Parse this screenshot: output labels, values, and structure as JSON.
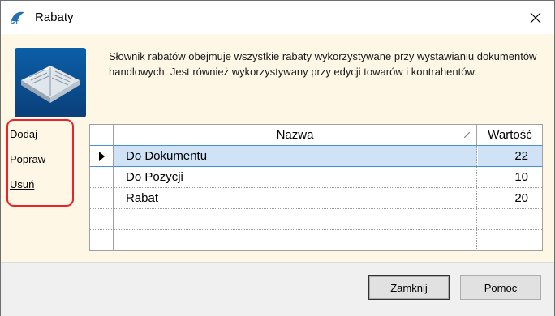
{
  "window": {
    "title": "Rabaty"
  },
  "description": "Słownik rabatów obejmuje wszystkie rabaty wykorzystywane przy wystawianiu dokumentów handlowych. Jest również wykorzystywany przy edycji towarów i kontrahentów.",
  "actions": [
    {
      "label": "Dodaj"
    },
    {
      "label": "Popraw"
    },
    {
      "label": "Usuń"
    }
  ],
  "grid": {
    "columns": {
      "name": "Nazwa",
      "value": "Wartość"
    },
    "rows": [
      {
        "name": "Do Dokumentu",
        "value": "22",
        "selected": true
      },
      {
        "name": "Do Pozycji",
        "value": "10"
      },
      {
        "name": "Rabat",
        "value": "20"
      }
    ]
  },
  "buttons": {
    "close": "Zamknij",
    "help": "Pomoc"
  },
  "colors": {
    "selection": "#cfe2f6",
    "highlight_border": "#e8232a",
    "background": "#fff7e6"
  }
}
